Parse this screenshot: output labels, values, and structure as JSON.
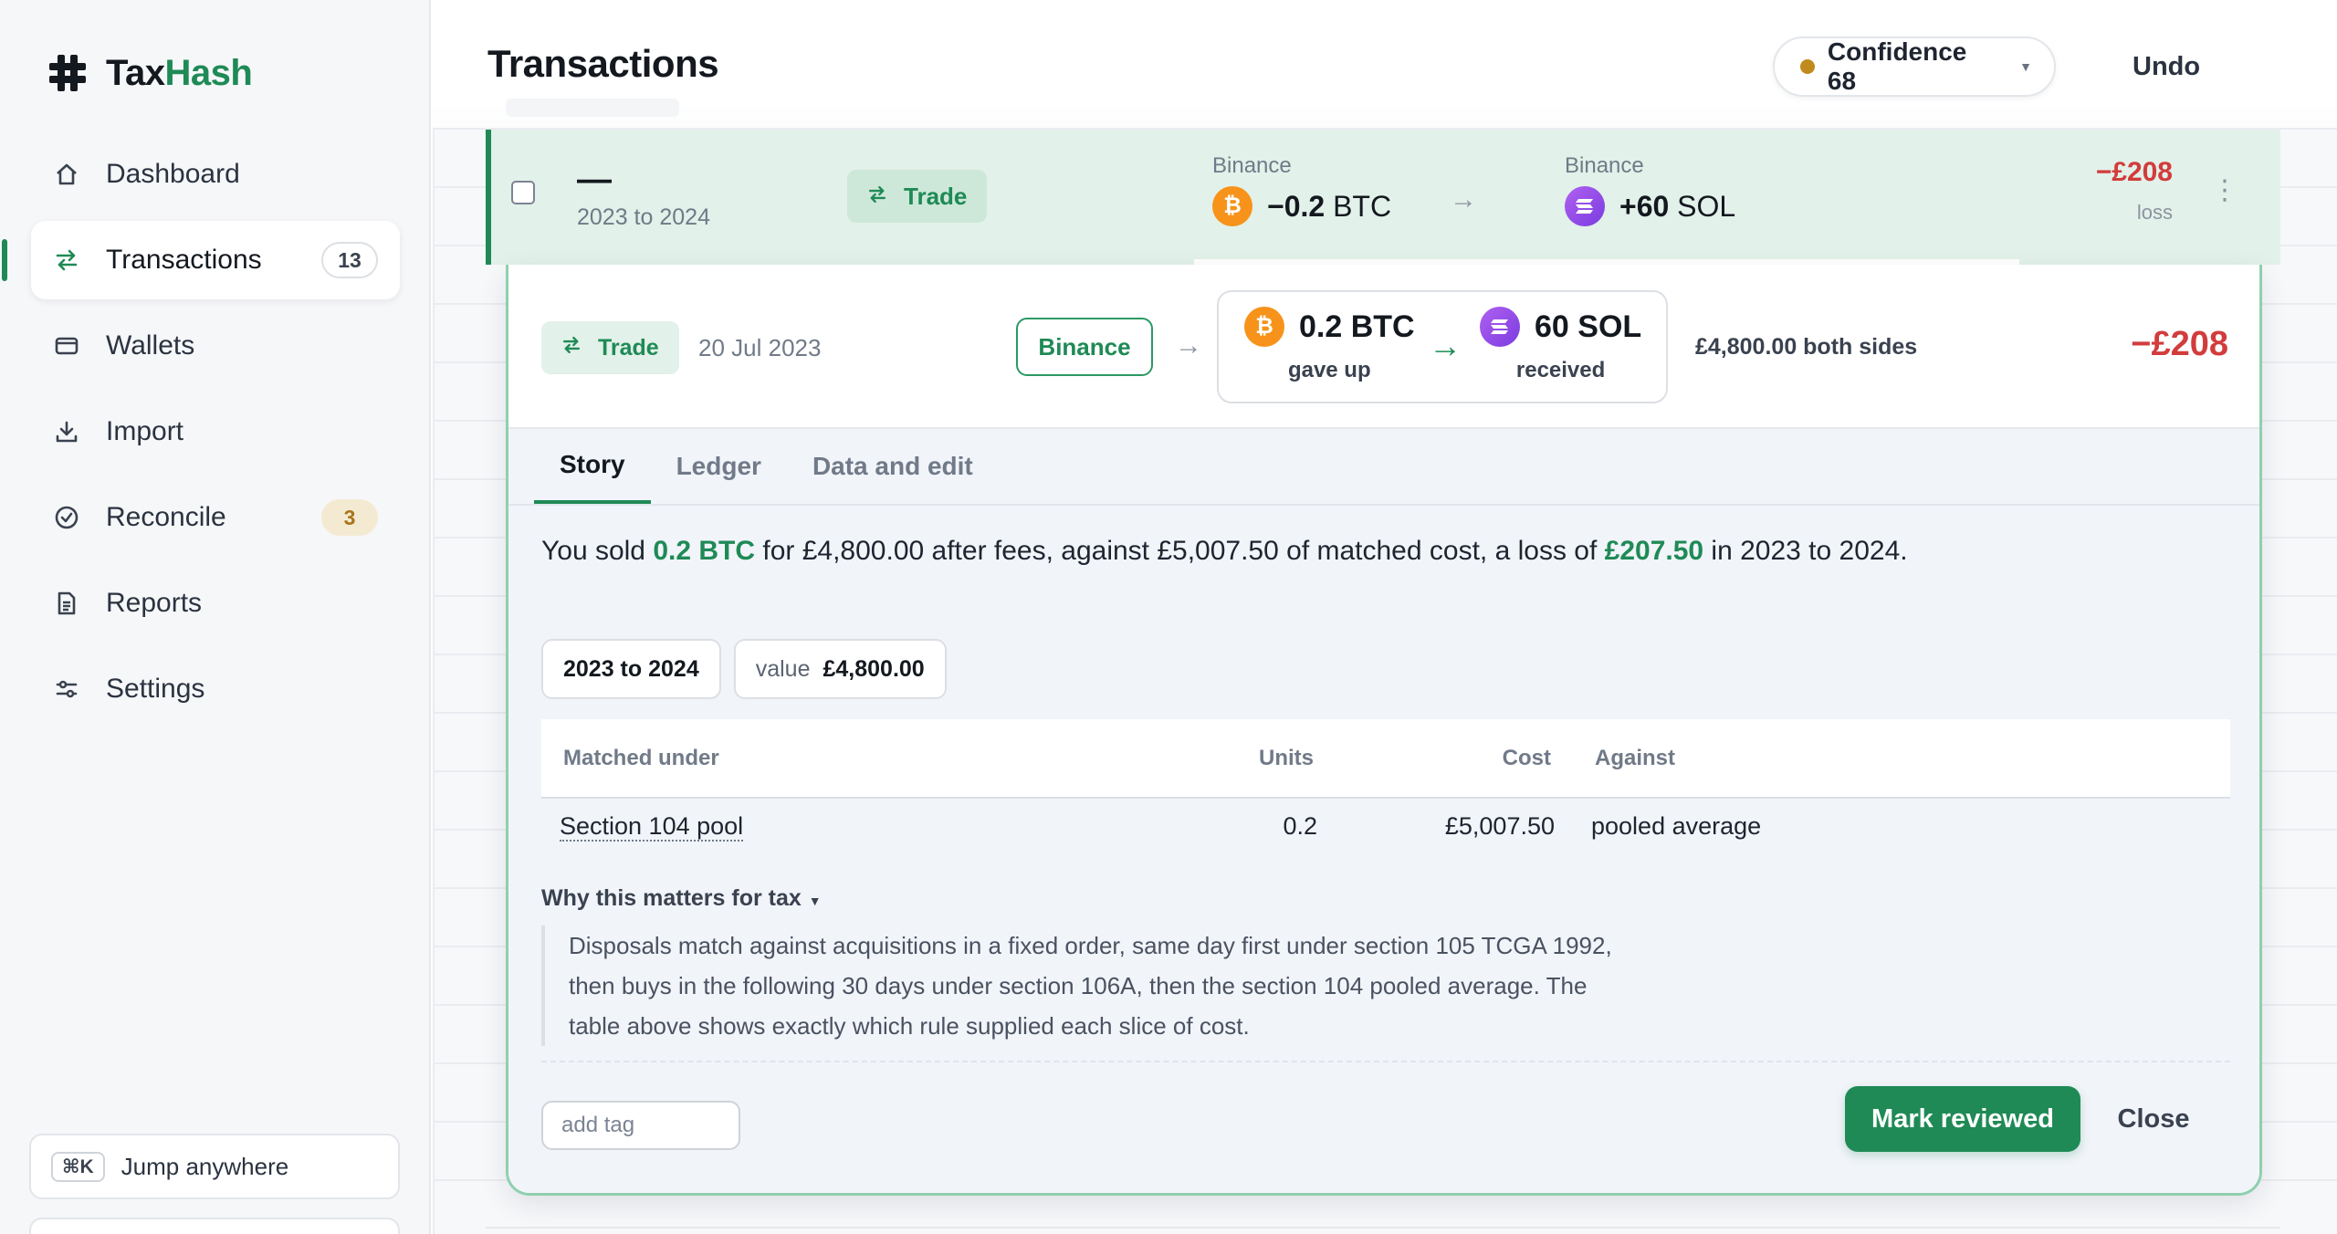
{
  "app": {
    "logo_tax": "Tax",
    "logo_hash": "Hash"
  },
  "sidebar": {
    "items": [
      {
        "label": "Dashboard",
        "icon": "home-icon"
      },
      {
        "label": "Transactions",
        "icon": "swap-icon",
        "badge": "13",
        "active": true
      },
      {
        "label": "Wallets",
        "icon": "wallet-icon"
      },
      {
        "label": "Import",
        "icon": "download-icon"
      },
      {
        "label": "Reconcile",
        "icon": "check-circle-icon",
        "badge": "3"
      },
      {
        "label": "Reports",
        "icon": "document-icon"
      },
      {
        "label": "Settings",
        "icon": "sliders-icon"
      }
    ],
    "jump": {
      "kbd": "⌘K",
      "label": "Jump anywhere"
    }
  },
  "header": {
    "title": "Transactions",
    "confidence": "Confidence 68",
    "undo": "Undo"
  },
  "row": {
    "name": "—",
    "year": "2023 to 2024",
    "type": "Trade",
    "from": {
      "exchange": "Binance",
      "amount": "−0.2",
      "asset": "BTC"
    },
    "to": {
      "exchange": "Binance",
      "amount": "+60",
      "asset": "SOL"
    },
    "amount": "−£208",
    "amount_sub": "loss"
  },
  "detail": {
    "summary": {
      "type": "Trade",
      "date": "20 Jul 2023",
      "exchange": "Binance",
      "gave_amount": "0.2 BTC",
      "gave_label": "gave up",
      "recv_amount": "60 SOL",
      "recv_label": "received",
      "both_sides": "£4,800.00 both sides",
      "amount": "−£208"
    },
    "tabs": [
      "Story",
      "Ledger",
      "Data and edit"
    ],
    "story": {
      "p1": "You sold ",
      "hl1": "0.2 BTC",
      "p2": " for £4,800.00 after fees, against £5,007.50 of matched cost, a loss of ",
      "hl2": "£207.50",
      "p3": " in 2023 to 2024."
    },
    "chips": {
      "year": "2023 to 2024",
      "value_label": "value",
      "value": "£4,800.00"
    },
    "table": {
      "headers": [
        "Matched under",
        "Units",
        "Cost",
        "Against"
      ],
      "rows": [
        {
          "rule": "Section 104 pool",
          "units": "0.2",
          "cost": "£5,007.50",
          "against": "pooled average"
        }
      ]
    },
    "why_title": "Why this matters for tax",
    "why_text": "Disposals match against acquisitions in a fixed order, same day first under section 105 TCGA 1992, then buys in the following 30 days under section 106A, then the section 104 pooled average. The table above shows exactly which rule supplied each slice of cost.",
    "tag_placeholder": "add tag",
    "mark_reviewed": "Mark reviewed",
    "close": "Close"
  },
  "colors": {
    "accent": "#1f8a56",
    "loss": "#d23c3c",
    "btc": "#f7931a",
    "sol": "#9945ff",
    "confidence_dot": "#c08a1c"
  }
}
